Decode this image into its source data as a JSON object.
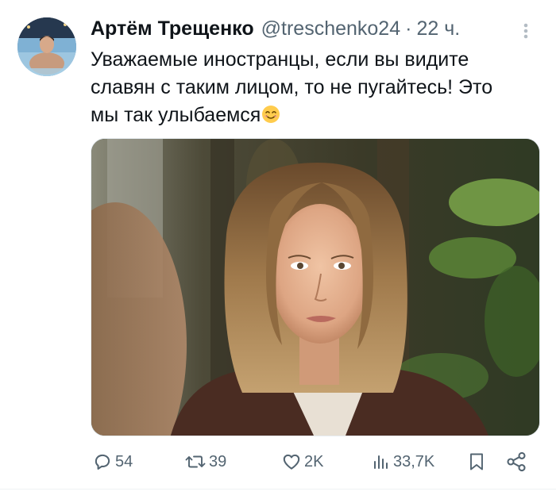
{
  "author": {
    "display_name": "Артём Трещенко",
    "handle": "@treschenko24",
    "separator": "·",
    "time": "22 ч."
  },
  "tweet": {
    "line1": "Уважаемые иностранцы, если вы видите",
    "line2": "славян с таким лицом, то не пугайтесь! Это",
    "line3": "мы так улыбаемся",
    "emoji": "smiling-face-with-smiling-eyes"
  },
  "actions": {
    "replies": "54",
    "retweets": "39",
    "likes": "2K",
    "views": "33,7K"
  },
  "colors": {
    "text": "#0f1419",
    "secondary": "#536471",
    "divider": "#eff3f4"
  },
  "icons": [
    "more-vertical-icon",
    "reply-icon",
    "retweet-icon",
    "like-icon",
    "views-icon",
    "bookmark-icon",
    "share-icon"
  ]
}
